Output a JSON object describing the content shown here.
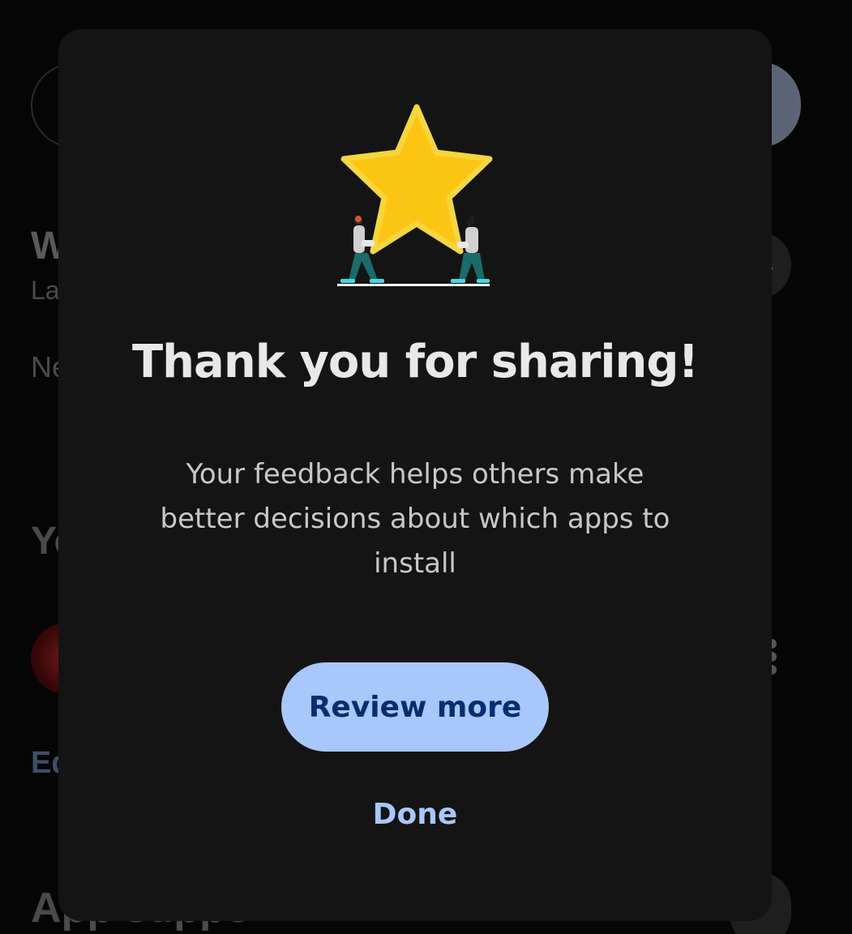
{
  "background": {
    "header_partial": "W",
    "subtext_partial": "La",
    "line_partial": "Ne",
    "section_partial": "Yo",
    "link_partial": "Ed",
    "bottom_section_partial": "App suppo"
  },
  "dialog": {
    "title": "Thank you for sharing!",
    "body": "Your feedback helps others make better decisions about which apps to install",
    "primary_button_label": "Review more",
    "secondary_button_label": "Done",
    "illustration_icon": "star-carried-by-people-illustration"
  },
  "colors": {
    "dialog_background": "#141414",
    "primary_button_bg": "#a8c7fa",
    "primary_button_text": "#062e6f",
    "done_text": "#a8c7fa",
    "star": "#fdc513"
  }
}
